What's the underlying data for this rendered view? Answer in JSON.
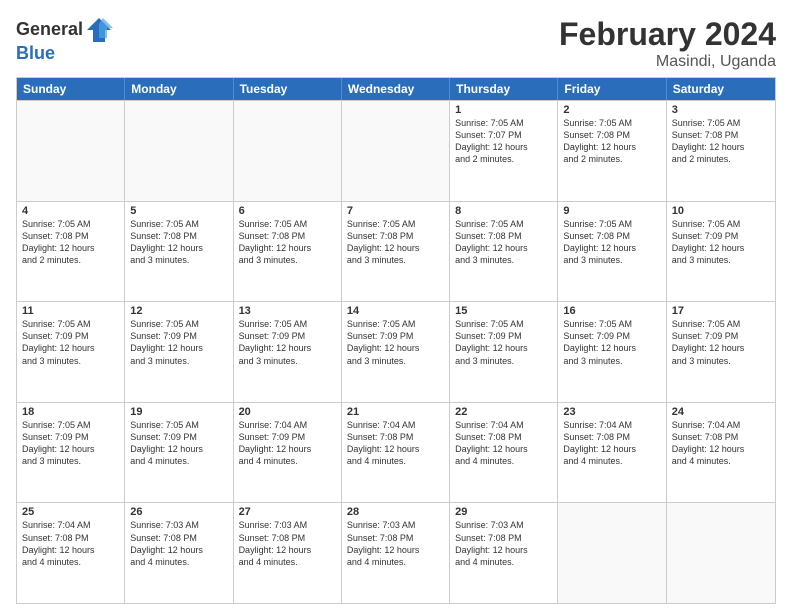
{
  "logo": {
    "general": "General",
    "blue": "Blue"
  },
  "title": {
    "month": "February 2024",
    "location": "Masindi, Uganda"
  },
  "header_days": [
    "Sunday",
    "Monday",
    "Tuesday",
    "Wednesday",
    "Thursday",
    "Friday",
    "Saturday"
  ],
  "weeks": [
    [
      {
        "day": "",
        "info": "",
        "empty": true
      },
      {
        "day": "",
        "info": "",
        "empty": true
      },
      {
        "day": "",
        "info": "",
        "empty": true
      },
      {
        "day": "",
        "info": "",
        "empty": true
      },
      {
        "day": "1",
        "info": "Sunrise: 7:05 AM\nSunset: 7:07 PM\nDaylight: 12 hours\nand 2 minutes."
      },
      {
        "day": "2",
        "info": "Sunrise: 7:05 AM\nSunset: 7:08 PM\nDaylight: 12 hours\nand 2 minutes."
      },
      {
        "day": "3",
        "info": "Sunrise: 7:05 AM\nSunset: 7:08 PM\nDaylight: 12 hours\nand 2 minutes."
      }
    ],
    [
      {
        "day": "4",
        "info": "Sunrise: 7:05 AM\nSunset: 7:08 PM\nDaylight: 12 hours\nand 2 minutes."
      },
      {
        "day": "5",
        "info": "Sunrise: 7:05 AM\nSunset: 7:08 PM\nDaylight: 12 hours\nand 3 minutes."
      },
      {
        "day": "6",
        "info": "Sunrise: 7:05 AM\nSunset: 7:08 PM\nDaylight: 12 hours\nand 3 minutes."
      },
      {
        "day": "7",
        "info": "Sunrise: 7:05 AM\nSunset: 7:08 PM\nDaylight: 12 hours\nand 3 minutes."
      },
      {
        "day": "8",
        "info": "Sunrise: 7:05 AM\nSunset: 7:08 PM\nDaylight: 12 hours\nand 3 minutes."
      },
      {
        "day": "9",
        "info": "Sunrise: 7:05 AM\nSunset: 7:08 PM\nDaylight: 12 hours\nand 3 minutes."
      },
      {
        "day": "10",
        "info": "Sunrise: 7:05 AM\nSunset: 7:09 PM\nDaylight: 12 hours\nand 3 minutes."
      }
    ],
    [
      {
        "day": "11",
        "info": "Sunrise: 7:05 AM\nSunset: 7:09 PM\nDaylight: 12 hours\nand 3 minutes."
      },
      {
        "day": "12",
        "info": "Sunrise: 7:05 AM\nSunset: 7:09 PM\nDaylight: 12 hours\nand 3 minutes."
      },
      {
        "day": "13",
        "info": "Sunrise: 7:05 AM\nSunset: 7:09 PM\nDaylight: 12 hours\nand 3 minutes."
      },
      {
        "day": "14",
        "info": "Sunrise: 7:05 AM\nSunset: 7:09 PM\nDaylight: 12 hours\nand 3 minutes."
      },
      {
        "day": "15",
        "info": "Sunrise: 7:05 AM\nSunset: 7:09 PM\nDaylight: 12 hours\nand 3 minutes."
      },
      {
        "day": "16",
        "info": "Sunrise: 7:05 AM\nSunset: 7:09 PM\nDaylight: 12 hours\nand 3 minutes."
      },
      {
        "day": "17",
        "info": "Sunrise: 7:05 AM\nSunset: 7:09 PM\nDaylight: 12 hours\nand 3 minutes."
      }
    ],
    [
      {
        "day": "18",
        "info": "Sunrise: 7:05 AM\nSunset: 7:09 PM\nDaylight: 12 hours\nand 3 minutes."
      },
      {
        "day": "19",
        "info": "Sunrise: 7:05 AM\nSunset: 7:09 PM\nDaylight: 12 hours\nand 4 minutes."
      },
      {
        "day": "20",
        "info": "Sunrise: 7:04 AM\nSunset: 7:09 PM\nDaylight: 12 hours\nand 4 minutes."
      },
      {
        "day": "21",
        "info": "Sunrise: 7:04 AM\nSunset: 7:08 PM\nDaylight: 12 hours\nand 4 minutes."
      },
      {
        "day": "22",
        "info": "Sunrise: 7:04 AM\nSunset: 7:08 PM\nDaylight: 12 hours\nand 4 minutes."
      },
      {
        "day": "23",
        "info": "Sunrise: 7:04 AM\nSunset: 7:08 PM\nDaylight: 12 hours\nand 4 minutes."
      },
      {
        "day": "24",
        "info": "Sunrise: 7:04 AM\nSunset: 7:08 PM\nDaylight: 12 hours\nand 4 minutes."
      }
    ],
    [
      {
        "day": "25",
        "info": "Sunrise: 7:04 AM\nSunset: 7:08 PM\nDaylight: 12 hours\nand 4 minutes."
      },
      {
        "day": "26",
        "info": "Sunrise: 7:03 AM\nSunset: 7:08 PM\nDaylight: 12 hours\nand 4 minutes."
      },
      {
        "day": "27",
        "info": "Sunrise: 7:03 AM\nSunset: 7:08 PM\nDaylight: 12 hours\nand 4 minutes."
      },
      {
        "day": "28",
        "info": "Sunrise: 7:03 AM\nSunset: 7:08 PM\nDaylight: 12 hours\nand 4 minutes."
      },
      {
        "day": "29",
        "info": "Sunrise: 7:03 AM\nSunset: 7:08 PM\nDaylight: 12 hours\nand 4 minutes."
      },
      {
        "day": "",
        "info": "",
        "empty": true
      },
      {
        "day": "",
        "info": "",
        "empty": true
      }
    ]
  ]
}
